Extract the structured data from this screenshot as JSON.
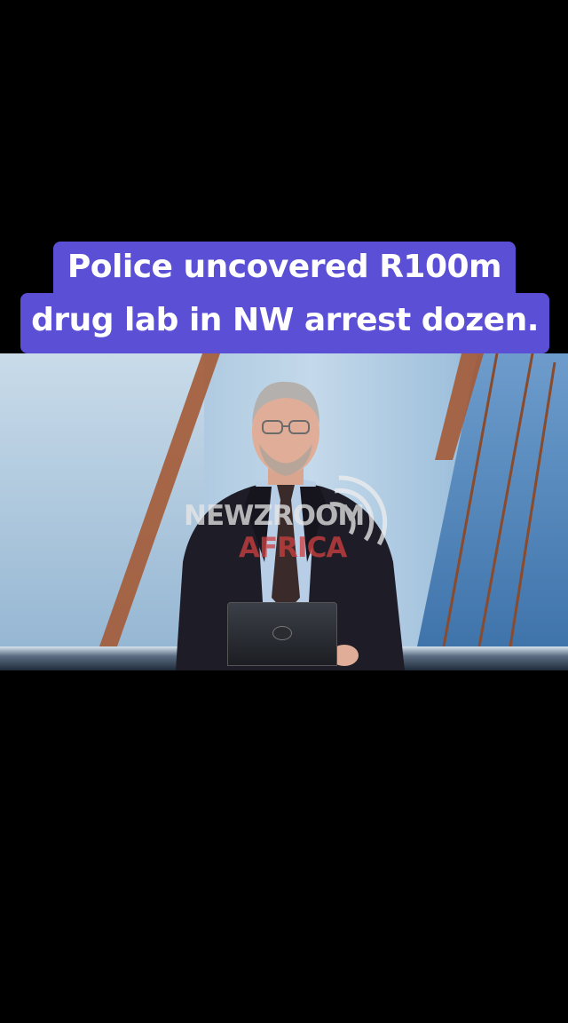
{
  "caption": {
    "line1": "Police uncovered R100m",
    "line2": "drug lab in NW arrest dozen."
  },
  "watermark": {
    "top": "NEWZROOM",
    "bottom": "AFRICA"
  },
  "colors": {
    "background": "#000000",
    "caption_bg": "#5b4fd6",
    "caption_text": "#ffffff"
  }
}
